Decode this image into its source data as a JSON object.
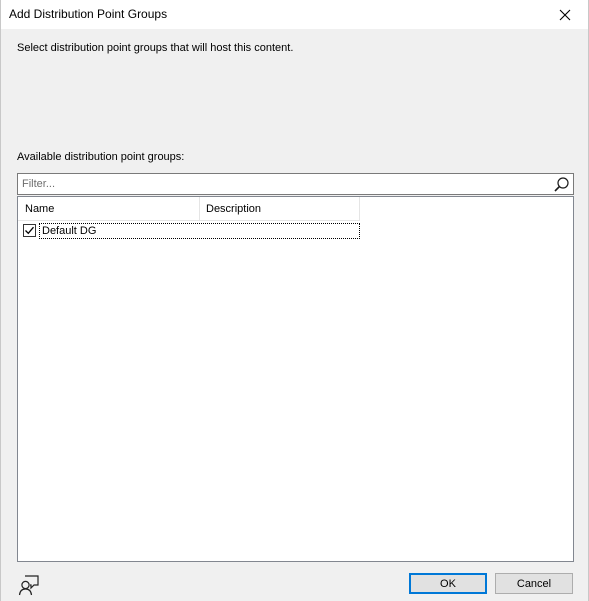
{
  "window": {
    "title": "Add Distribution Point Groups",
    "close_icon": "close-icon"
  },
  "main": {
    "instruction": "Select distribution point groups that will host this content.",
    "available_label": "Available distribution point groups:",
    "filter": {
      "value": "",
      "placeholder": "Filter...",
      "icon": "search-icon"
    },
    "list": {
      "columns": [
        "Name",
        "Description"
      ],
      "rows": [
        {
          "checked": true,
          "name": "Default DG",
          "description": ""
        }
      ]
    }
  },
  "footer": {
    "feedback_icon": "feedback-icon",
    "ok_label": "OK",
    "cancel_label": "Cancel"
  },
  "colors": {
    "accent": "#0078d7",
    "dialog_bg": "#f0f0f0"
  }
}
